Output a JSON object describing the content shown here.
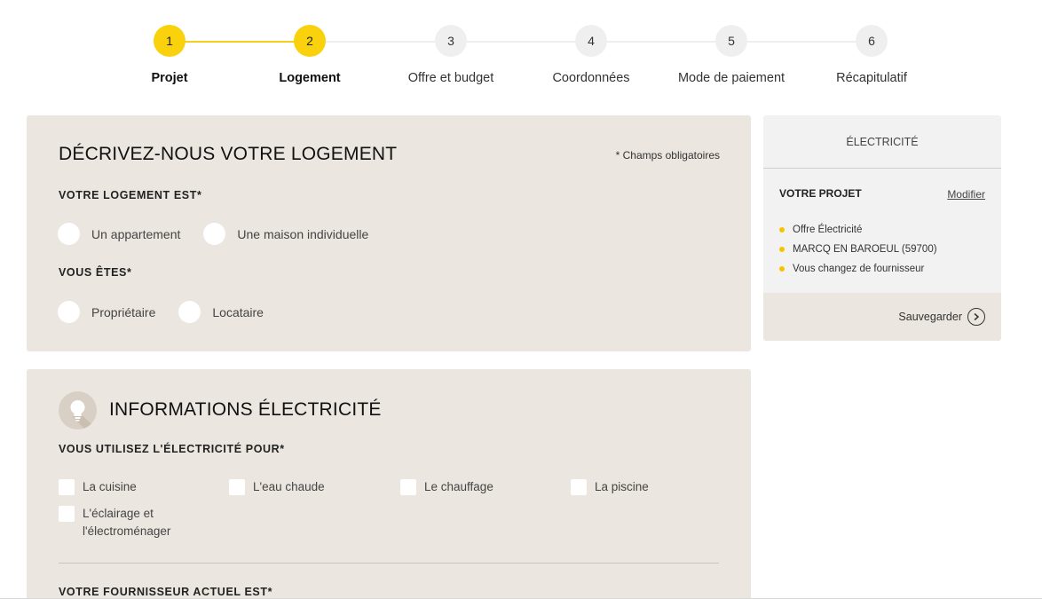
{
  "stepper": {
    "steps": [
      {
        "number": "1",
        "label": "Projet",
        "state": "done"
      },
      {
        "number": "2",
        "label": "Logement",
        "state": "current"
      },
      {
        "number": "3",
        "label": "Offre et budget",
        "state": "upcoming"
      },
      {
        "number": "4",
        "label": "Coordonnées",
        "state": "upcoming"
      },
      {
        "number": "5",
        "label": "Mode de paiement",
        "state": "upcoming"
      },
      {
        "number": "6",
        "label": "Récapitulatif",
        "state": "upcoming"
      }
    ]
  },
  "housing": {
    "title": "DÉCRIVEZ-NOUS VOTRE LOGEMENT",
    "required_note": "* Champs obligatoires",
    "housing_type": {
      "label": "VOTRE LOGEMENT EST*",
      "options": [
        "Un appartement",
        "Une maison individuelle"
      ]
    },
    "status": {
      "label": "VOUS ÊTES*",
      "options": [
        "Propriétaire",
        "Locataire"
      ]
    }
  },
  "electricity": {
    "icon": "lightbulb-icon",
    "title": "INFORMATIONS ÉLECTRICITÉ",
    "usage": {
      "label": "VOUS UTILISEZ L'ÉLECTRICITÉ POUR*",
      "options": [
        "La cuisine",
        "L'eau chaude",
        "Le chauffage",
        "La piscine",
        "L'éclairage et l'électroménager"
      ]
    },
    "supplier_label": "VOTRE FOURNISSEUR ACTUEL EST*"
  },
  "sidebar": {
    "header": "ÉLECTRICITÉ",
    "project_title": "VOTRE PROJET",
    "modify_label": "Modifier",
    "items": [
      "Offre Électricité",
      "MARCQ EN BAROEUL (59700)",
      "Vous changez de fournisseur"
    ],
    "save_label": "Sauvegarder",
    "save_icon": "chevron-right-circle-icon"
  },
  "colors": {
    "accent": "#f9d10d",
    "card_bg": "#ebe6df",
    "sidebar_bg": "#f2f2f2"
  }
}
